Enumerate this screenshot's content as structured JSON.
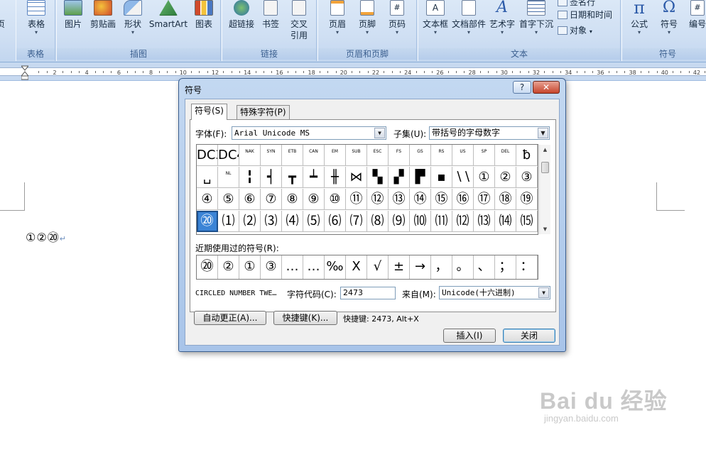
{
  "ribbon": {
    "groups": [
      {
        "label": "表格",
        "buttons": [
          {
            "label": "表格"
          }
        ]
      },
      {
        "label": "插图",
        "buttons": [
          {
            "label": "图片"
          },
          {
            "label": "剪贴画"
          },
          {
            "label": "形状"
          },
          {
            "label": "SmartArt"
          },
          {
            "label": "图表"
          }
        ]
      },
      {
        "label": "链接",
        "buttons": [
          {
            "label": "超链接"
          },
          {
            "label": "书签"
          },
          {
            "label": "交叉"
          },
          {
            "label": "引用"
          }
        ]
      },
      {
        "label": "页眉和页脚",
        "buttons": [
          {
            "label": "页眉"
          },
          {
            "label": "页脚"
          },
          {
            "label": "页码"
          }
        ]
      },
      {
        "label": "文本",
        "buttons": [
          {
            "label": "文本框"
          },
          {
            "label": "文档部件"
          },
          {
            "label": "艺术字"
          },
          {
            "label": "首字下沉"
          }
        ]
      },
      {
        "label": "符号",
        "buttons": [
          {
            "label": "公式"
          },
          {
            "label": "符号"
          },
          {
            "label": "编号"
          }
        ]
      }
    ],
    "edge_label": "页",
    "text_small": {
      "signature": "签名行",
      "datetime": "日期和时间",
      "object": "对象"
    }
  },
  "ruler": {
    "ticks": [
      "2",
      "4",
      "6",
      "8",
      "10",
      "12",
      "14",
      "16",
      "18",
      "20",
      "22",
      "24",
      "26",
      "28",
      "30",
      "32",
      "34",
      "36",
      "38",
      "40",
      "42"
    ]
  },
  "document": {
    "text": "①②⑳",
    "para_mark": "↵"
  },
  "dialog": {
    "title": "符号",
    "help": "?",
    "close": "✕",
    "tabs": {
      "symbols": "符号(S)",
      "special": "特殊字符(P)"
    },
    "font_label": "字体(F):",
    "font_value": "Arial Unicode MS",
    "subset_label": "子集(U):",
    "subset_value": "带括号的字母数字",
    "grid_rows": [
      [
        "DC3",
        "DC4",
        "NAK",
        "SYN",
        "ETB",
        "CAN",
        "EM",
        "SUB",
        "ESC",
        "FS",
        "GS",
        "RS",
        "US",
        "SP",
        "DEL",
        "ƀ"
      ],
      [
        "␣",
        "NL",
        "╏",
        "┥",
        "┳",
        "┷",
        "╫",
        "⋈",
        "▚",
        "▞",
        "▛",
        "▪",
        "∖∖",
        "①",
        "②",
        "③"
      ],
      [
        "④",
        "⑤",
        "⑥",
        "⑦",
        "⑧",
        "⑨",
        "⑩",
        "⑪",
        "⑫",
        "⑬",
        "⑭",
        "⑮",
        "⑯",
        "⑰",
        "⑱",
        "⑲"
      ],
      [
        "⑳",
        "⑴",
        "⑵",
        "⑶",
        "⑷",
        "⑸",
        "⑹",
        "⑺",
        "⑻",
        "⑼",
        "⑽",
        "⑾",
        "⑿",
        "⒀",
        "⒁",
        "⒂"
      ]
    ],
    "selected_cell": "⑳",
    "recent_label": "近期使用过的符号(R):",
    "recent": [
      "⑳",
      "②",
      "①",
      "③",
      "…",
      "…",
      "‰",
      "Ⅹ",
      "√",
      "±",
      "→",
      "，",
      "。",
      "、",
      "；",
      "："
    ],
    "char_name": "CIRCLED NUMBER TWE…",
    "code_label": "字符代码(C):",
    "code_value": "2473",
    "from_label": "来自(M):",
    "from_value": "Unicode(十六进制)",
    "autocorrect_btn": "自动更正(A)...",
    "shortcut_btn": "快捷键(K)...",
    "shortcut_text": "快捷键: 2473, Alt+X",
    "insert_btn": "插入(I)",
    "close_btn": "关闭"
  },
  "watermark": {
    "brand": "Bai du 经验",
    "url": "jingyan.baidu.com"
  }
}
